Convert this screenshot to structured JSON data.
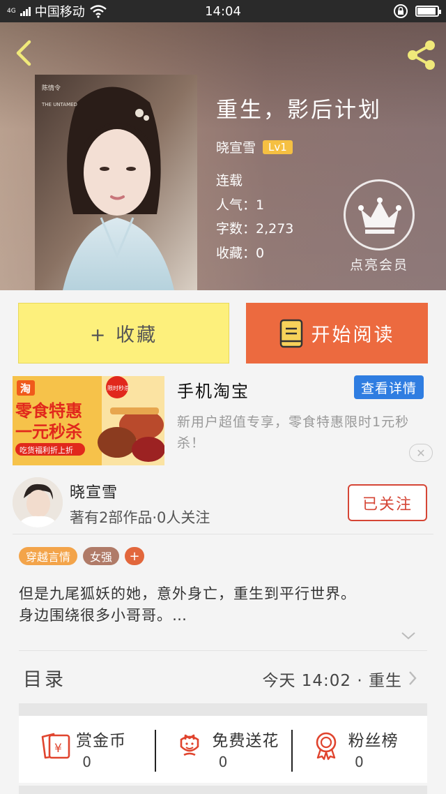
{
  "status_bar": {
    "network": "4G",
    "carrier": "中国移动",
    "time": "14:04"
  },
  "header": {
    "background_colors": [
      "#b9a08f",
      "#887272"
    ]
  },
  "book": {
    "title": "重生，影后计划",
    "author": "晓宣雪",
    "level": "Lv1",
    "status": "连载",
    "popularity": "人气：1",
    "word_count": "字数：2,273",
    "favorites": "收藏：0"
  },
  "vip": {
    "label": "点亮会员"
  },
  "actions": {
    "collect_label": "+ 收藏",
    "read_label": "开始阅读",
    "collect_color": "#fdf07c",
    "read_color": "#ec6a3f"
  },
  "ad": {
    "banner_line1": "零食特惠",
    "banner_line2": "一元秒杀",
    "banner_badge": "限时秒杀",
    "banner_footer": "吃货福利折上折",
    "banner_logo": "淘",
    "title": "手机淘宝",
    "detail_label": "查看详情",
    "description": "新用户超值专享，零食特惠限时1元秒杀！",
    "close_symbol": "✕"
  },
  "author_card": {
    "name": "晓宣雪",
    "stats": "著有2部作品·0人关注",
    "follow_label": "已关注"
  },
  "tags": {
    "items": [
      "穿越言情",
      "女强"
    ],
    "add": "+"
  },
  "intro": {
    "line1": "但是九尾狐妖的她，意外身亡，重生到平行世界。",
    "line2": "身边围绕很多小哥哥。…"
  },
  "toc": {
    "label": "目录",
    "latest": "今天 14:02 · 重生"
  },
  "rewards": {
    "items": [
      {
        "label": "赏金币",
        "count": "0",
        "icon": "red-envelope-icon"
      },
      {
        "label": "免费送花",
        "count": "0",
        "icon": "flower-icon"
      },
      {
        "label": "粉丝榜",
        "count": "0",
        "icon": "medal-icon"
      }
    ],
    "accent": "#e0442e"
  }
}
